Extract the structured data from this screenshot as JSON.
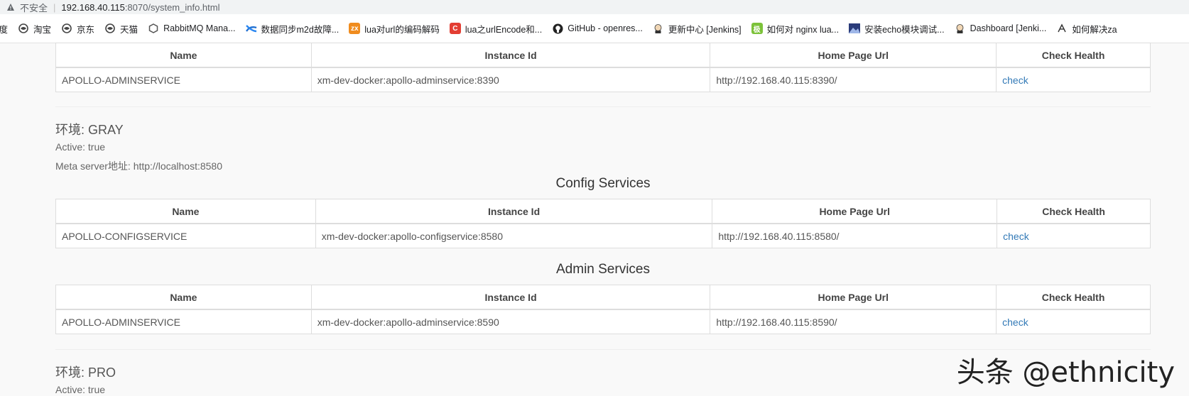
{
  "browser": {
    "security_label": "不安全",
    "url_host": "192.168.40.115",
    "url_rest": ":8070/system_info.html"
  },
  "bookmarks": [
    {
      "label": "百度",
      "icon": "baidu-icon"
    },
    {
      "label": "淘宝",
      "icon": "globe-icon"
    },
    {
      "label": "京东",
      "icon": "globe-icon"
    },
    {
      "label": "天猫",
      "icon": "globe-icon"
    },
    {
      "label": "RabbitMQ Mana...",
      "icon": "rabbitmq-icon"
    },
    {
      "label": "数据同步m2d故障...",
      "icon": "confluence-icon"
    },
    {
      "label": "lua对url的编码解码",
      "icon": "zx-icon"
    },
    {
      "label": "lua之urlEncode和...",
      "icon": "csdn-icon"
    },
    {
      "label": "GitHub - openres...",
      "icon": "github-icon"
    },
    {
      "label": "更新中心 [Jenkins]",
      "icon": "jenkins-icon"
    },
    {
      "label": "如何对 nginx lua...",
      "icon": "green-square-icon"
    },
    {
      "label": "安装echo模块调试...",
      "icon": "image-icon"
    },
    {
      "label": "Dashboard [Jenki...",
      "icon": "jenkins-icon"
    },
    {
      "label": "如何解决za",
      "icon": "bookmark-icon"
    }
  ],
  "table_headers": {
    "name": "Name",
    "instance_id": "Instance Id",
    "home_page_url": "Home Page Url",
    "check_health": "Check Health"
  },
  "top_table": {
    "row": {
      "name": "APOLLO-ADMINSERVICE",
      "instance_id": "xm-dev-docker:apollo-adminservice:8390",
      "home_page_url": "http://192.168.40.115:8390/",
      "check": "check"
    }
  },
  "gray_env": {
    "title": "环境: GRAY",
    "active": "Active: true",
    "meta": "Meta server地址: http://localhost:8580",
    "config_title": "Config Services",
    "config_row": {
      "name": "APOLLO-CONFIGSERVICE",
      "instance_id": "xm-dev-docker:apollo-configservice:8580",
      "home_page_url": "http://192.168.40.115:8580/",
      "check": "check"
    },
    "admin_title": "Admin Services",
    "admin_row": {
      "name": "APOLLO-ADMINSERVICE",
      "instance_id": "xm-dev-docker:apollo-adminservice:8590",
      "home_page_url": "http://192.168.40.115:8590/",
      "check": "check"
    }
  },
  "pro_env": {
    "title": "环境: PRO",
    "active": "Active: true"
  },
  "watermark": "头条 @ethnicity"
}
